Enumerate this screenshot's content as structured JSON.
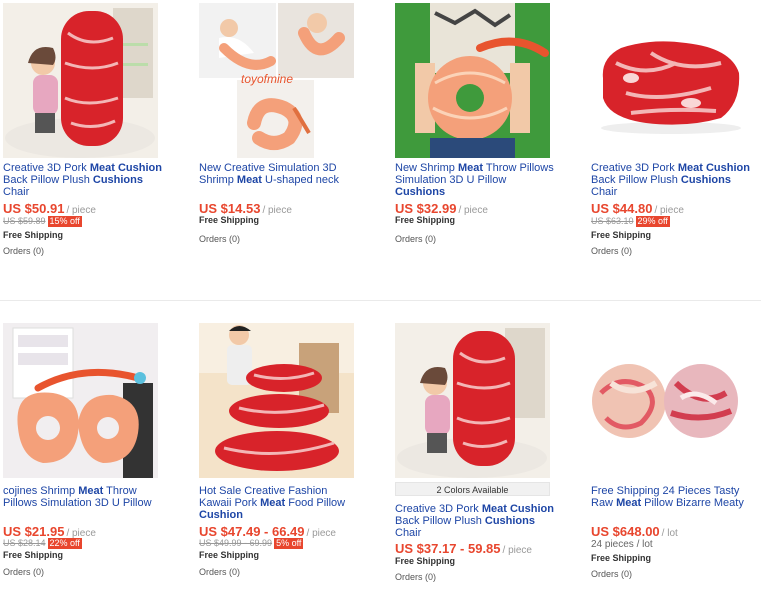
{
  "products": [
    {
      "title_parts": [
        "Creative 3D Pork ",
        "Meat",
        " ",
        "Cushion",
        " Back Pillow Plush ",
        "Cushions",
        " Chair"
      ],
      "price": "US $50.91",
      "unit": "/ piece",
      "old_price": "US $59.89",
      "discount": "15% off",
      "shipping": "Free Shipping",
      "orders": "Orders (0)"
    },
    {
      "title_parts": [
        "New Creative Simulation 3D Shrimp ",
        "Meat",
        " U-shaped neck"
      ],
      "price": "US $14.53",
      "unit": "/ piece",
      "shipping": "Free Shipping",
      "orders": "Orders (0)",
      "watermark": "toyofmine"
    },
    {
      "title_parts": [
        "New Shrimp ",
        "Meat",
        " Throw Pillows Simulation 3D U Pillow ",
        "Cushions",
        ""
      ],
      "price": "US $32.99",
      "unit": "/ piece",
      "shipping": "Free Shipping",
      "orders": "Orders (0)"
    },
    {
      "title_parts": [
        "Creative 3D Pork ",
        "Meat",
        " ",
        "Cushion",
        " Back Pillow Plush ",
        "Cushions",
        " Chair"
      ],
      "price": "US $44.80",
      "unit": "/ piece",
      "old_price": "US $63.10",
      "discount": "29% off",
      "shipping": "Free Shipping",
      "orders": "Orders (0)"
    },
    {
      "title_parts": [
        "cojines Shrimp ",
        "Meat",
        " Throw Pillows Simulation 3D U Pillow",
        "",
        ""
      ],
      "price": "US $21.95",
      "unit": "/ piece",
      "old_price": "US $28.14",
      "discount": "22% off",
      "shipping": "Free Shipping",
      "orders": "Orders (0)"
    },
    {
      "title_parts": [
        "Hot Sale Creative Fashion Kawaii Pork ",
        "Meat",
        " Food Pillow ",
        "Cushion",
        ""
      ],
      "price": "US $47.49 - 66.49",
      "unit": "/ piece",
      "old_price": "US $49.99 - 69.99",
      "discount": "5% off",
      "shipping": "Free Shipping",
      "orders": "Orders (0)"
    },
    {
      "colors_available": "2 Colors Available",
      "title_parts": [
        "Creative 3D Pork ",
        "Meat",
        " ",
        "Cushion",
        " Back Pillow Plush ",
        "Cushions",
        " Chair"
      ],
      "price": "US $37.17 - 59.85",
      "unit": "/ piece",
      "shipping": "Free Shipping",
      "orders": "Orders (0)"
    },
    {
      "title_parts": [
        "Free Shipping 24 Pieces Tasty Raw ",
        "Meat",
        " Pillow Bizarre Meaty",
        "",
        ""
      ],
      "price": "US $648.00",
      "unit": "/ lot",
      "lot": "24 pieces / lot",
      "shipping": "Free Shipping",
      "orders": "Orders (0)"
    }
  ],
  "colors": {
    "price": "#e8462e",
    "link": "#1e46a6",
    "meat": "#d8232a",
    "shrimp": "#f4a07a"
  }
}
